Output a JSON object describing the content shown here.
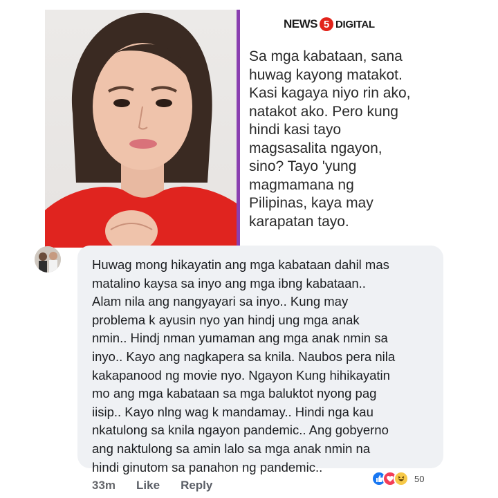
{
  "post": {
    "brand": {
      "part1": "NEWS",
      "number": "5",
      "part2": "DIGITAL"
    },
    "quote_lines": [
      "Sa mga kabataan, sana",
      "huwag kayong matakot.",
      "Kasi kagaya niyo rin ako,",
      "natakot ako. Pero kung",
      "hindi kasi tayo",
      "magsasalita ngayon,",
      "sino? Tayo 'yung",
      "magmamana ng",
      "Pilipinas, kaya may",
      "karapatan tayo."
    ],
    "accent_color": "#8a3fb0"
  },
  "comment": {
    "lines": [
      "Huwag mong hikayatin ang mga kabataan dahil mas",
      "matalino kaysa sa inyo ang mga ibng kabataan..",
      "Alam  nila ang nangyayari sa inyo.. Kung may",
      "problema k ayusin nyo yan hindj ung mga anak",
      "nmin.. Hindj nman yumaman ang mga anak nmin sa",
      "inyo.. Kayo ang nagkapera sa knila. Naubos pera nila",
      "kakapanood ng movie nyo. Ngayon Kung hihikayatin",
      "mo  ang mga kabataan sa mga baluktot nyong pag",
      "iisip.. Kayo nlng wag k mandamay.. Hindi nga kau",
      "nkatulong sa knila ngayon pandemic.. Ang gobyerno",
      "ang naktulong sa amin lalo sa mga anak nmin na",
      "hindi ginutom sa panahon ng pandemic.."
    ],
    "time": "33m",
    "like_label": "Like",
    "reply_label": "Reply",
    "reaction_count": "50",
    "reactions": [
      "like-icon",
      "love-icon",
      "haha-icon"
    ]
  }
}
